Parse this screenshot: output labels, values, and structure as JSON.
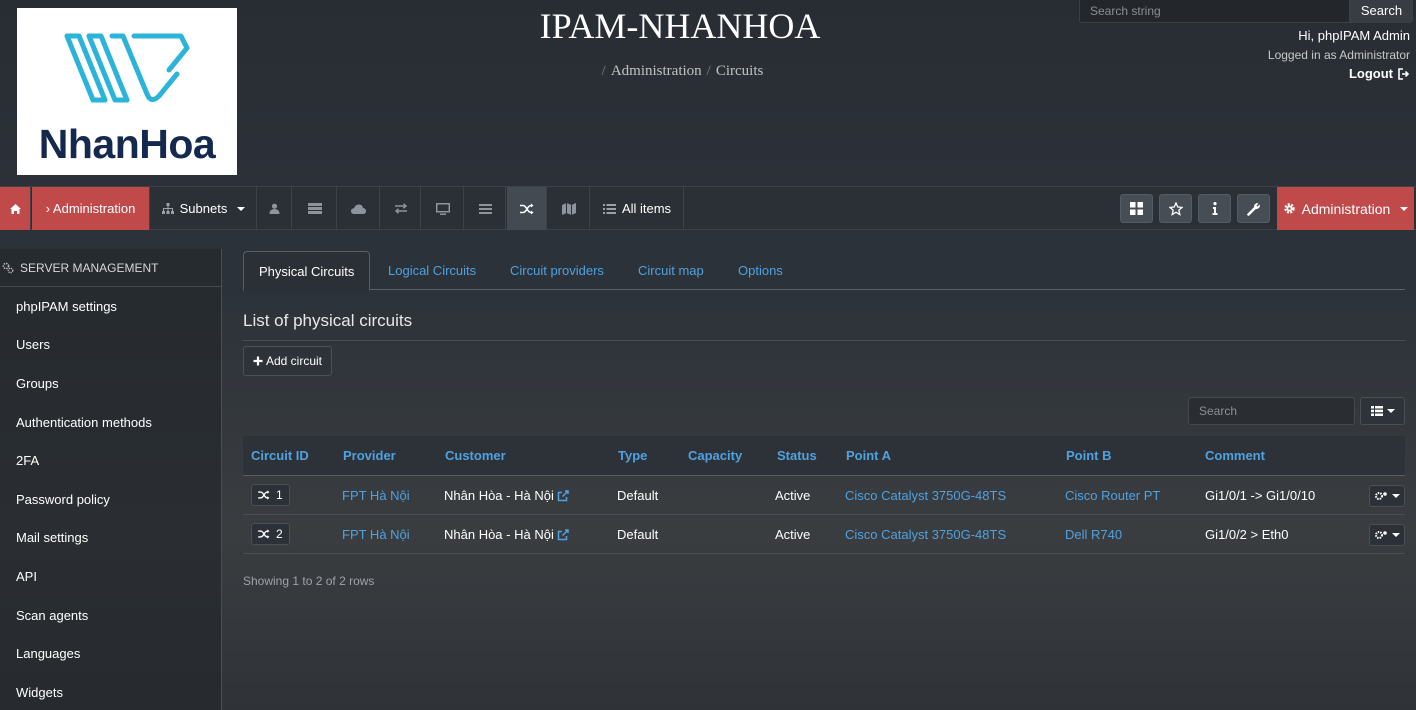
{
  "header": {
    "logo_text": "NhanHoa",
    "site_title": "IPAM-NHANHOA",
    "breadcrumb": [
      "Administration",
      "Circuits"
    ],
    "search": {
      "placeholder": "Search string",
      "button": "Search"
    },
    "user": {
      "greeting": "Hi, phpIPAM Admin",
      "logged_in": "Logged in as  Administrator",
      "logout": "Logout"
    }
  },
  "nav": {
    "home_icon": "home-icon",
    "admin_crumb": "› Administration",
    "subnets": "Subnets",
    "all_items": "All items",
    "admin_menu": "Administration"
  },
  "sidebar": {
    "header": "SERVER MANAGEMENT",
    "items": [
      "phpIPAM settings",
      "Users",
      "Groups",
      "Authentication methods",
      "2FA",
      "Password policy",
      "Mail settings",
      "API",
      "Scan agents",
      "Languages",
      "Widgets"
    ]
  },
  "tabs": [
    "Physical Circuits",
    "Logical Circuits",
    "Circuit providers",
    "Circuit map",
    "Options"
  ],
  "main": {
    "title": "List of physical circuits",
    "add_button": "Add circuit",
    "search_placeholder": "Search",
    "columns": [
      "Circuit ID",
      "Provider",
      "Customer",
      "Type",
      "Capacity",
      "Status",
      "Point A",
      "Point B",
      "Comment"
    ],
    "rows": [
      {
        "id": "1",
        "provider": "FPT Hà Nội",
        "customer": "Nhân Hòa - Hà Nội",
        "type": "Default",
        "capacity": "",
        "status": "Active",
        "point_a": "Cisco Catalyst 3750G-48TS",
        "point_b": "Cisco Router PT",
        "comment": "Gi1/0/1 -> Gi1/0/10"
      },
      {
        "id": "2",
        "provider": "FPT Hà Nội",
        "customer": "Nhân Hòa - Hà Nội",
        "type": "Default",
        "capacity": "",
        "status": "Active",
        "point_a": "Cisco Catalyst 3750G-48TS",
        "point_b": "Dell R740",
        "comment": "Gi1/0/2 > Eth0"
      }
    ],
    "showing": "Showing 1 to 2 of 2 rows"
  },
  "colors": {
    "accent_red": "#c0494a",
    "link_blue": "#4fa1e0",
    "logo_cyan": "#2bb3d9",
    "logo_navy": "#14294d"
  }
}
